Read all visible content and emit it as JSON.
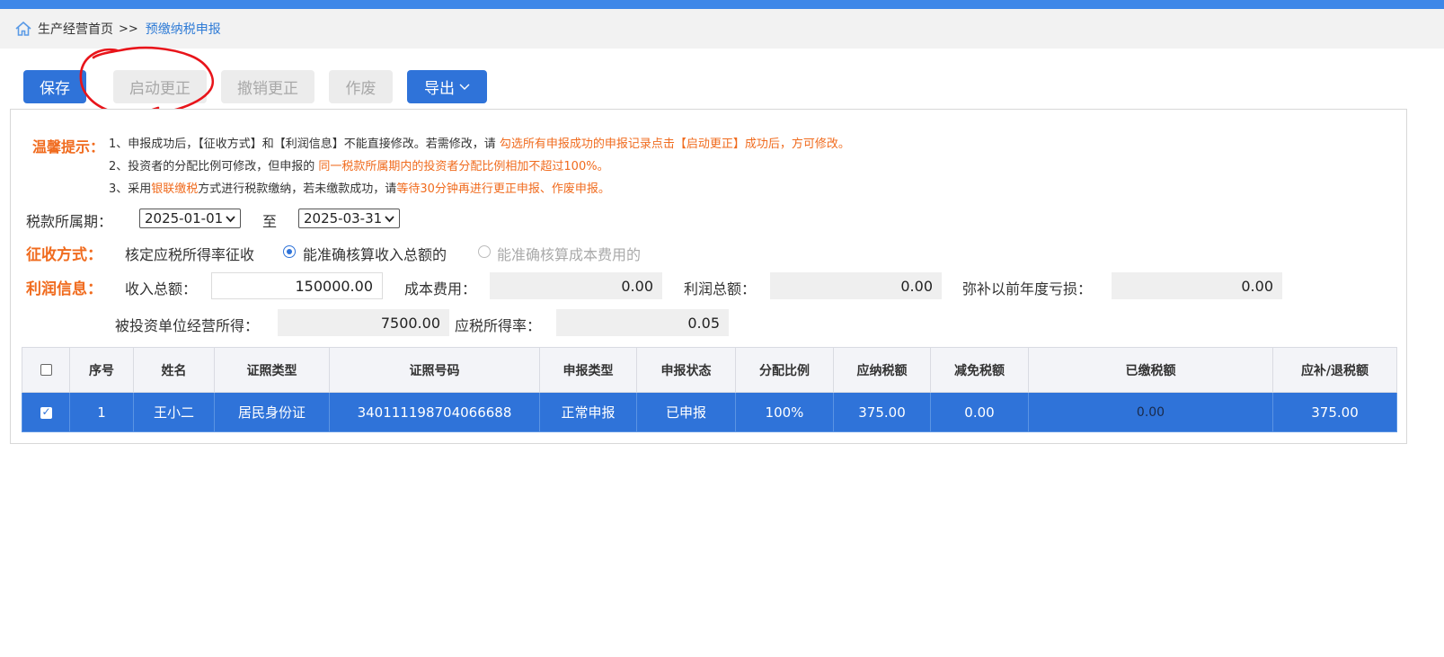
{
  "breadcrumb": {
    "home_label": "生产经营首页",
    "separator": ">>",
    "current": "预缴纳税申报"
  },
  "toolbar": {
    "save": "保存",
    "start_correction": "启动更正",
    "revoke_correction": "撤销更正",
    "void": "作废",
    "export": "导出"
  },
  "tips": {
    "title": "温馨提示：",
    "tip1_a": "1、申报成功后，【征收方式】和【利润信息】不能直接修改。若需修改，请 ",
    "tip1_b": "勾选所有申报成功的申报记录点击【启动更正】成功后，方可修改。",
    "tip2_a": "2、投资者的分配比例可修改，但申报的 ",
    "tip2_b": "同一税款所属期内的投资者分配比例相加不超过100%。",
    "tip3_a": "3、采用",
    "tip3_b": "银联缴税",
    "tip3_c": "方式进行税款缴纳，若未缴款成功，请",
    "tip3_d": "等待30分钟再进行更正申报、作废申报。"
  },
  "period": {
    "label": "税款所属期：",
    "start": "2025-01-01",
    "to": "至",
    "end": "2025-03-31"
  },
  "collection": {
    "label": "征收方式：",
    "method": "核定应税所得率征收",
    "option1": "能准确核算收入总额的",
    "option2": "能准确核算成本费用的",
    "selected": "option1"
  },
  "profit": {
    "label": "利润信息：",
    "total_income_label": "收入总额：",
    "total_income": "150000.00",
    "cost_label": "成本费用：",
    "cost": "0.00",
    "profit_total_label": "利润总额：",
    "profit_total": "0.00",
    "loss_offset_label": "弥补以前年度亏损：",
    "loss_offset": "0.00",
    "invested_income_label": "被投资单位经营所得：",
    "invested_income": "7500.00",
    "taxable_rate_label": "应税所得率：",
    "taxable_rate": "0.05"
  },
  "table": {
    "headers": [
      "序号",
      "姓名",
      "证照类型",
      "证照号码",
      "申报类型",
      "申报状态",
      "分配比例",
      "应纳税额",
      "减免税额",
      "已缴税额",
      "应补/退税额"
    ],
    "rows": [
      {
        "checked": true,
        "cells": [
          "1",
          "王小二",
          "居民身份证",
          "340111198704066688",
          "正常申报",
          "已申报",
          "100%",
          "375.00",
          "0.00",
          "0.00",
          "375.00"
        ]
      }
    ]
  },
  "colors": {
    "primary": "#2f73d9",
    "warning": "#f06b1e",
    "topbar": "#3d87e8",
    "annotation": "#e8141a"
  }
}
